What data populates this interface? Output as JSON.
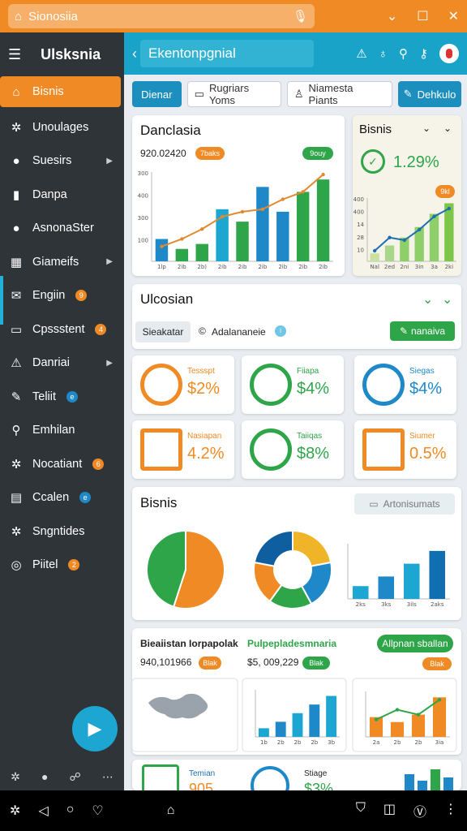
{
  "browser": {
    "url": "Sionosiia"
  },
  "sidebar": {
    "title": "Ulsksnia",
    "items": [
      {
        "label": "Bisnis",
        "icon": "briefcase-icon",
        "glyph": "⌂",
        "active": true
      },
      {
        "label": "Unoulages",
        "icon": "gear-icon",
        "glyph": "✲"
      },
      {
        "label": "Suesirs",
        "icon": "user-icon",
        "glyph": "●",
        "arrow": true
      },
      {
        "label": "Danpa",
        "icon": "bar-chart-icon",
        "glyph": "▮"
      },
      {
        "label": "AsnonaSter",
        "icon": "user-icon",
        "glyph": "●"
      },
      {
        "label": "Giameifs",
        "icon": "grid-icon",
        "glyph": "▦",
        "arrow": true
      },
      {
        "label": "Engiin",
        "icon": "mail-icon",
        "glyph": "✉",
        "badge": "9",
        "badge_color": "orange"
      },
      {
        "label": "Cpssstent",
        "icon": "document-icon",
        "glyph": "▭",
        "badge": "4",
        "badge_color": "orange"
      },
      {
        "label": "Danriai",
        "icon": "warning-icon",
        "glyph": "⚠",
        "arrow": true
      },
      {
        "label": "Teliit",
        "icon": "edit-icon",
        "glyph": "✎",
        "badge": "e",
        "badge_color": "blue"
      },
      {
        "label": "Emhilan",
        "icon": "search-icon",
        "glyph": "⚲"
      },
      {
        "label": "Nocatiant",
        "icon": "gear-icon",
        "glyph": "✲",
        "badge": "6",
        "badge_color": "orange"
      },
      {
        "label": "Ccalen",
        "icon": "calendar-icon",
        "glyph": "▤",
        "badge": "e",
        "badge_color": "blue"
      },
      {
        "label": "Sngntides",
        "icon": "gear-icon",
        "glyph": "✲"
      },
      {
        "label": "Piitel",
        "icon": "compass-icon",
        "glyph": "◎",
        "badge": "2",
        "badge_color": "orange"
      }
    ]
  },
  "header": {
    "title": "Ekentonpgnial"
  },
  "tabs": [
    {
      "label": "Dienar",
      "active": true
    },
    {
      "label": "Rugriars Yoms",
      "icon": "document-icon"
    },
    {
      "label": "Niamesta Piants",
      "icon": "user-icon"
    },
    {
      "label": "Dehkulo",
      "icon": "edit-icon",
      "active": true
    }
  ],
  "card1": {
    "title": "Danclasia",
    "value": "920.02420",
    "badge": "7baks",
    "badge2": "9ouy"
  },
  "card2": {
    "title": "Bisnis",
    "value": "1.29%",
    "badge": "9kl"
  },
  "section": {
    "title": "Ulcosian",
    "filter": "Sieakatar",
    "filter2": "Adalananeie",
    "button": "nanaiva"
  },
  "kpis": [
    {
      "label": "Tessspt",
      "value": "$2%",
      "icon": "user-icon",
      "color": "#f08a24"
    },
    {
      "label": "Fiiapa",
      "value": "$4%",
      "icon": "check-icon",
      "color": "#2fa54a"
    },
    {
      "label": "Siegas",
      "value": "$4%",
      "icon": "gear-icon",
      "color": "#1e88c8"
    },
    {
      "label": "Nasiapan",
      "value": "4.2%",
      "icon": "server-icon",
      "color": "#f08a24"
    },
    {
      "label": "Taiiqas",
      "value": "$8%",
      "icon": "dollar-icon",
      "color": "#2fa54a"
    },
    {
      "label": "Siumer",
      "value": "0.5%",
      "icon": "line-chart-icon",
      "color": "#f08a24"
    }
  ],
  "card3": {
    "title": "Bisnis",
    "button": "Artonisumats"
  },
  "card4": {
    "title1": "Bieaiistan Iorpapolak",
    "title2": "Pulpepladesmnaria",
    "button": "Allpnan sballan",
    "value1": "940,101966",
    "value2": "$5, 009,229",
    "badge1": "Blak",
    "badge2": "Blak",
    "badge3": "Blak"
  },
  "card5": {
    "kpi1_label": "Temian",
    "kpi1_value": "905",
    "kpi2_label": "Stiage",
    "kpi2_value": "$3%"
  },
  "chart_data": [
    {
      "type": "bar",
      "title": "Danclasia",
      "categories": [
        "1lp",
        "2ib",
        "2b)",
        "2ib",
        "2ib",
        "2ib",
        "2ib",
        "2ib",
        "2ib"
      ],
      "series": [
        {
          "values": [
            90,
            50,
            70,
            210,
            160,
            300,
            200,
            280,
            330
          ]
        }
      ],
      "line": [
        60,
        90,
        130,
        180,
        200,
        210,
        250,
        280,
        350
      ],
      "yticks": [
        "300",
        "400",
        "300",
        "100"
      ],
      "ylim": [
        0,
        360
      ]
    },
    {
      "type": "bar",
      "title": "Bisnis",
      "categories": [
        "Nal",
        "2ed",
        "2ni",
        "3in",
        "3a",
        "2ki"
      ],
      "series": [
        {
          "values": [
            30,
            60,
            90,
            130,
            180,
            220
          ]
        }
      ],
      "line": [
        40,
        90,
        80,
        120,
        170,
        200
      ],
      "yticks": [
        "400",
        "400",
        "14",
        "28",
        "10"
      ],
      "ylim": [
        0,
        240
      ]
    },
    {
      "type": "pie",
      "values": [
        55,
        45
      ],
      "colors": [
        "#f08a24",
        "#2fa54a"
      ]
    },
    {
      "type": "pie",
      "values": [
        22,
        20,
        18,
        18,
        22
      ],
      "colors": [
        "#f0b428",
        "#1e88c8",
        "#2fa54a",
        "#f08a24",
        "#0f5fa0"
      ]
    },
    {
      "type": "bar",
      "categories": [
        "2ks",
        "3ks",
        "3ils",
        "2aks"
      ],
      "series": [
        {
          "values": [
            20,
            35,
            55,
            75
          ]
        }
      ]
    },
    {
      "type": "bar",
      "categories": [
        "1b",
        "2b",
        "2b",
        "2b",
        "3b"
      ],
      "series": [
        {
          "values": [
            20,
            35,
            55,
            75,
            95
          ]
        }
      ]
    },
    {
      "type": "bar",
      "categories": [
        "2a",
        "2b",
        "2b",
        "3ia"
      ],
      "series": [
        {
          "values": [
            40,
            30,
            45,
            80
          ]
        }
      ],
      "line": [
        35,
        55,
        45,
        75
      ]
    }
  ]
}
